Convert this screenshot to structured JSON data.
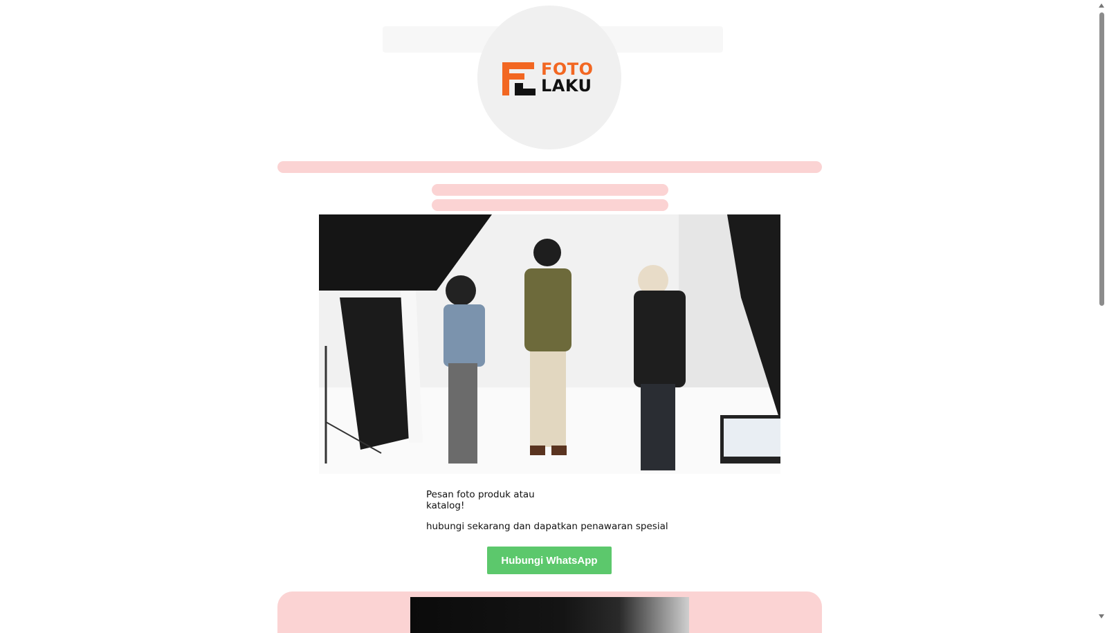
{
  "logo": {
    "line1": "FOTO",
    "line2": "LAKU",
    "brand_color": "#f26722",
    "dark_color": "#111111"
  },
  "hero_image": {
    "alt": "Foto studio session photo"
  },
  "content": {
    "headline": "Pesan foto produk atau katalog!",
    "subtext": "hubungi sekarang dan dapatkan penawaran spesial"
  },
  "cta": {
    "label": "Hubungi WhatsApp",
    "color": "#5cc86c"
  },
  "colors": {
    "pill": "#fbd3d3",
    "logo_bg": "#f0f0f0"
  },
  "icons": {
    "scroll_up": "triangle-up-icon",
    "scroll_down": "triangle-down-icon"
  }
}
